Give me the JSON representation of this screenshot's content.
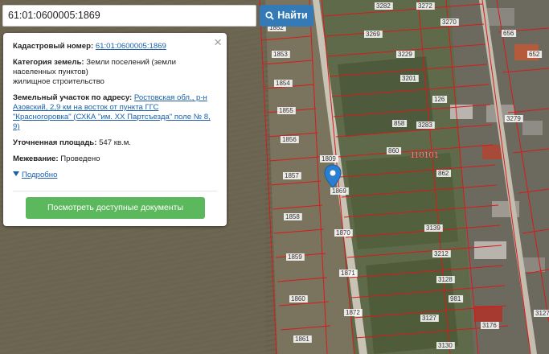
{
  "search": {
    "value": "61:01:0600005:1869",
    "button_label": "Найти"
  },
  "popup": {
    "cadastral_label": "Кадастровый номер:",
    "cadastral_value": "61:01:0600005:1869",
    "category_label": "Категория земель:",
    "category_value": "Земли поселений (земли населенных пунктов)",
    "category_use": "жилищное строительство",
    "address_label": "Земельный участок по адресу:",
    "address_value": "Ростовская обл., р-н Азовский, 2,9 км на восток от пункта ГГС \"Красногоровка\" (СХКА \"им. XX Партсъезда\" поле № 8, 9)",
    "area_label": "Уточненная площадь:",
    "area_value": "547 кв.м.",
    "survey_label": "Межевание:",
    "survey_value": "Проведено",
    "more_label": "Подробно",
    "docs_button": "Посмотреть доступные документы",
    "close_symbol": "×"
  },
  "map": {
    "marker_icon": "location-pin-icon",
    "big_label": "110101",
    "parcel_labels": [
      "3282",
      "3272",
      "3270",
      "3269",
      "3229",
      "3201",
      "126",
      "3283",
      "858",
      "860",
      "862",
      "1809",
      "1869",
      "1852",
      "1853",
      "1854",
      "1855",
      "1856",
      "1857",
      "1858",
      "1859",
      "1860",
      "1861",
      "1870",
      "1871",
      "1872",
      "3139",
      "3212",
      "3128",
      "3127",
      "3130",
      "981",
      "656",
      "652",
      "3279",
      "3127",
      "3176"
    ],
    "colors": {
      "parcel_line": "#d81a1a",
      "marker": "#2a7fd1",
      "road": "#c9c3b6"
    }
  }
}
